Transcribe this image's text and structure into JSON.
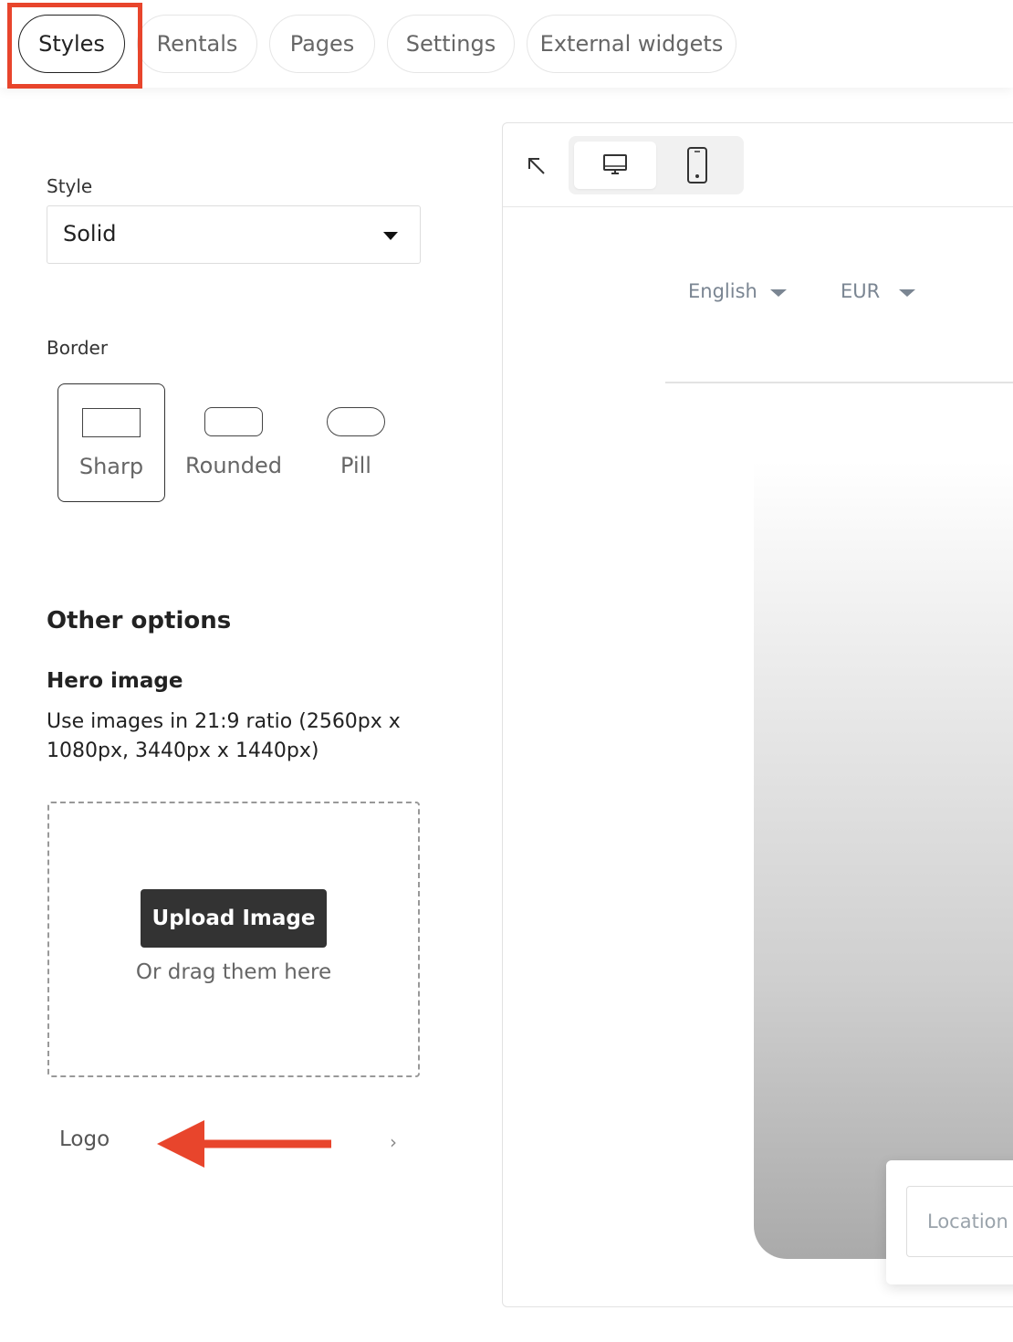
{
  "tabs": [
    {
      "label": "Styles",
      "active": true
    },
    {
      "label": "Rentals",
      "active": false
    },
    {
      "label": "Pages",
      "active": false
    },
    {
      "label": "Settings",
      "active": false
    },
    {
      "label": "External widgets",
      "active": false
    }
  ],
  "style_section": {
    "label": "Style",
    "selected": "Solid"
  },
  "border_section": {
    "label": "Border",
    "options": [
      "Sharp",
      "Rounded",
      "Pill"
    ],
    "selected": "Sharp"
  },
  "other_options": {
    "heading": "Other options",
    "hero_image": {
      "title": "Hero image",
      "description": "Use images in 21:9 ratio (2560px x 1080px, 3440px x 1440px)",
      "upload_button": "Upload Image",
      "drag_text": "Or drag them here"
    },
    "logo_label": "Logo"
  },
  "preview": {
    "language": "English",
    "currency": "EUR",
    "location_placeholder": "Location",
    "selected_device": "desktop"
  },
  "icons": {
    "collapse": "arrow-up-left-icon",
    "desktop": "monitor-icon",
    "mobile": "phone-icon",
    "chevron": "chevron-right-icon"
  },
  "colors": {
    "annotation": "#e8452c",
    "button_dark": "#333333",
    "muted_text": "#7a8592"
  }
}
